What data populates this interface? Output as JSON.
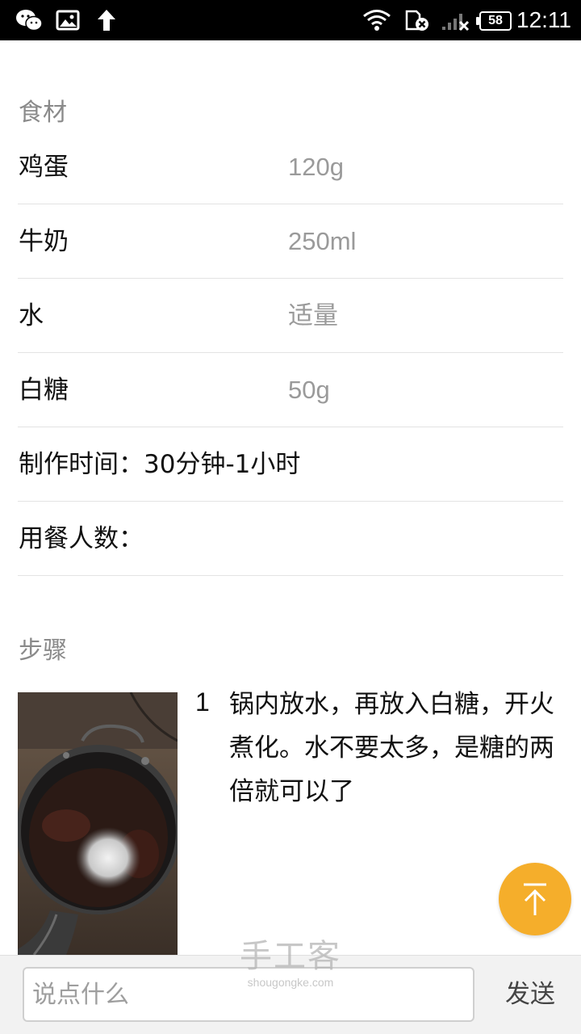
{
  "status_bar": {
    "time": "12:11",
    "battery": "58",
    "icons": [
      "wechat-icon",
      "gallery-icon",
      "upload-arrow-icon",
      "wifi-icon",
      "sim-card-icon",
      "signal-icon"
    ]
  },
  "ingredients": {
    "title": "食材",
    "items": [
      {
        "name": "鸡蛋",
        "qty": "120g"
      },
      {
        "name": "牛奶",
        "qty": "250ml"
      },
      {
        "name": "水",
        "qty": "适量"
      },
      {
        "name": "白糖",
        "qty": "50g"
      }
    ],
    "time_text": "制作时间：30分钟-1小时",
    "servings_text": "用餐人数："
  },
  "steps": {
    "title": "步骤",
    "items": [
      {
        "number": "1",
        "text": "锅内放水，再放入白糖，开火煮化。水不要太多，是糖的两倍就可以了"
      }
    ]
  },
  "comment": {
    "placeholder": "说点什么",
    "send_label": "发送"
  },
  "watermark": {
    "logo": "手工客",
    "url": "shougongke.com"
  },
  "colors": {
    "accent": "#f5ae2b",
    "muted_text": "#9a9a9a",
    "divider": "#e3e3e3"
  }
}
